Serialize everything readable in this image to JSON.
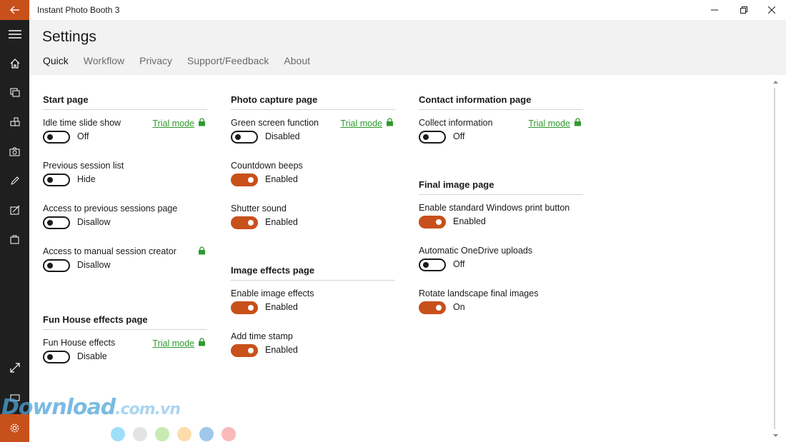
{
  "window": {
    "title": "Instant Photo Booth 3",
    "back_icon": "back-arrow-icon",
    "controls": [
      "minimize-icon",
      "maximize-icon",
      "close-icon"
    ]
  },
  "rail": {
    "items": [
      "hamburger-menu-icon",
      "home-icon",
      "gallery-icon",
      "apps-icon",
      "camera-icon",
      "pen-icon",
      "signature-icon",
      "bag-icon",
      "expand-icon",
      "screen-icon",
      "gear-icon"
    ]
  },
  "header": {
    "title": "Settings",
    "tabs": [
      {
        "label": "Quick",
        "active": true
      },
      {
        "label": "Workflow",
        "active": false
      },
      {
        "label": "Privacy",
        "active": false
      },
      {
        "label": "Support/Feedback",
        "active": false
      },
      {
        "label": "About",
        "active": false
      }
    ]
  },
  "trial_label": "Trial mode",
  "sections": {
    "start_page": {
      "title": "Start page",
      "settings": [
        {
          "label": "Idle time slide show",
          "trial": true,
          "on": false,
          "state": "Off"
        },
        {
          "label": "Previous session list",
          "trial": false,
          "on": false,
          "state": "Hide"
        },
        {
          "label": "Access to previous sessions page",
          "trial": false,
          "on": false,
          "state": "Disallow"
        },
        {
          "label": "Access to manual session creator",
          "trial": false,
          "lock_only": true,
          "on": false,
          "state": "Disallow"
        }
      ]
    },
    "fun_house": {
      "title": "Fun House effects page",
      "settings": [
        {
          "label": "Fun House effects",
          "trial": true,
          "on": false,
          "state": "Disable"
        }
      ]
    },
    "photo_capture": {
      "title": "Photo capture page",
      "settings": [
        {
          "label": "Green screen function",
          "trial": true,
          "on": false,
          "state": "Disabled"
        },
        {
          "label": "Countdown beeps",
          "trial": false,
          "on": true,
          "state": "Enabled"
        },
        {
          "label": "Shutter sound",
          "trial": false,
          "on": true,
          "state": "Enabled"
        }
      ]
    },
    "image_effects": {
      "title": "Image effects page",
      "settings": [
        {
          "label": "Enable image effects",
          "trial": false,
          "on": true,
          "state": "Enabled"
        },
        {
          "label": "Add time stamp",
          "trial": false,
          "on": true,
          "state": "Enabled"
        }
      ]
    },
    "contact_info": {
      "title": "Contact information page",
      "settings": [
        {
          "label": "Collect information",
          "trial": true,
          "on": false,
          "state": "Off"
        }
      ]
    },
    "final_image": {
      "title": "Final image page",
      "settings": [
        {
          "label": "Enable standard Windows print button",
          "trial": false,
          "on": true,
          "state": "Enabled"
        },
        {
          "label": "Automatic OneDrive uploads",
          "trial": false,
          "on": false,
          "state": "Off"
        },
        {
          "label": "Rotate landscape final images",
          "trial": false,
          "on": true,
          "state": "On"
        }
      ]
    }
  },
  "watermark": {
    "text": "Download",
    "domain": ".com.vn",
    "dot_colors": [
      "#7fd3f7",
      "#d9d9d9",
      "#b6e39a",
      "#fbd38f",
      "#7fb6e3",
      "#f7a1a1"
    ]
  },
  "colors": {
    "accent": "#c8501a",
    "trial_green": "#2e9a2e",
    "rail": "#1f1f1f",
    "header_bg": "#f2f2f2"
  }
}
